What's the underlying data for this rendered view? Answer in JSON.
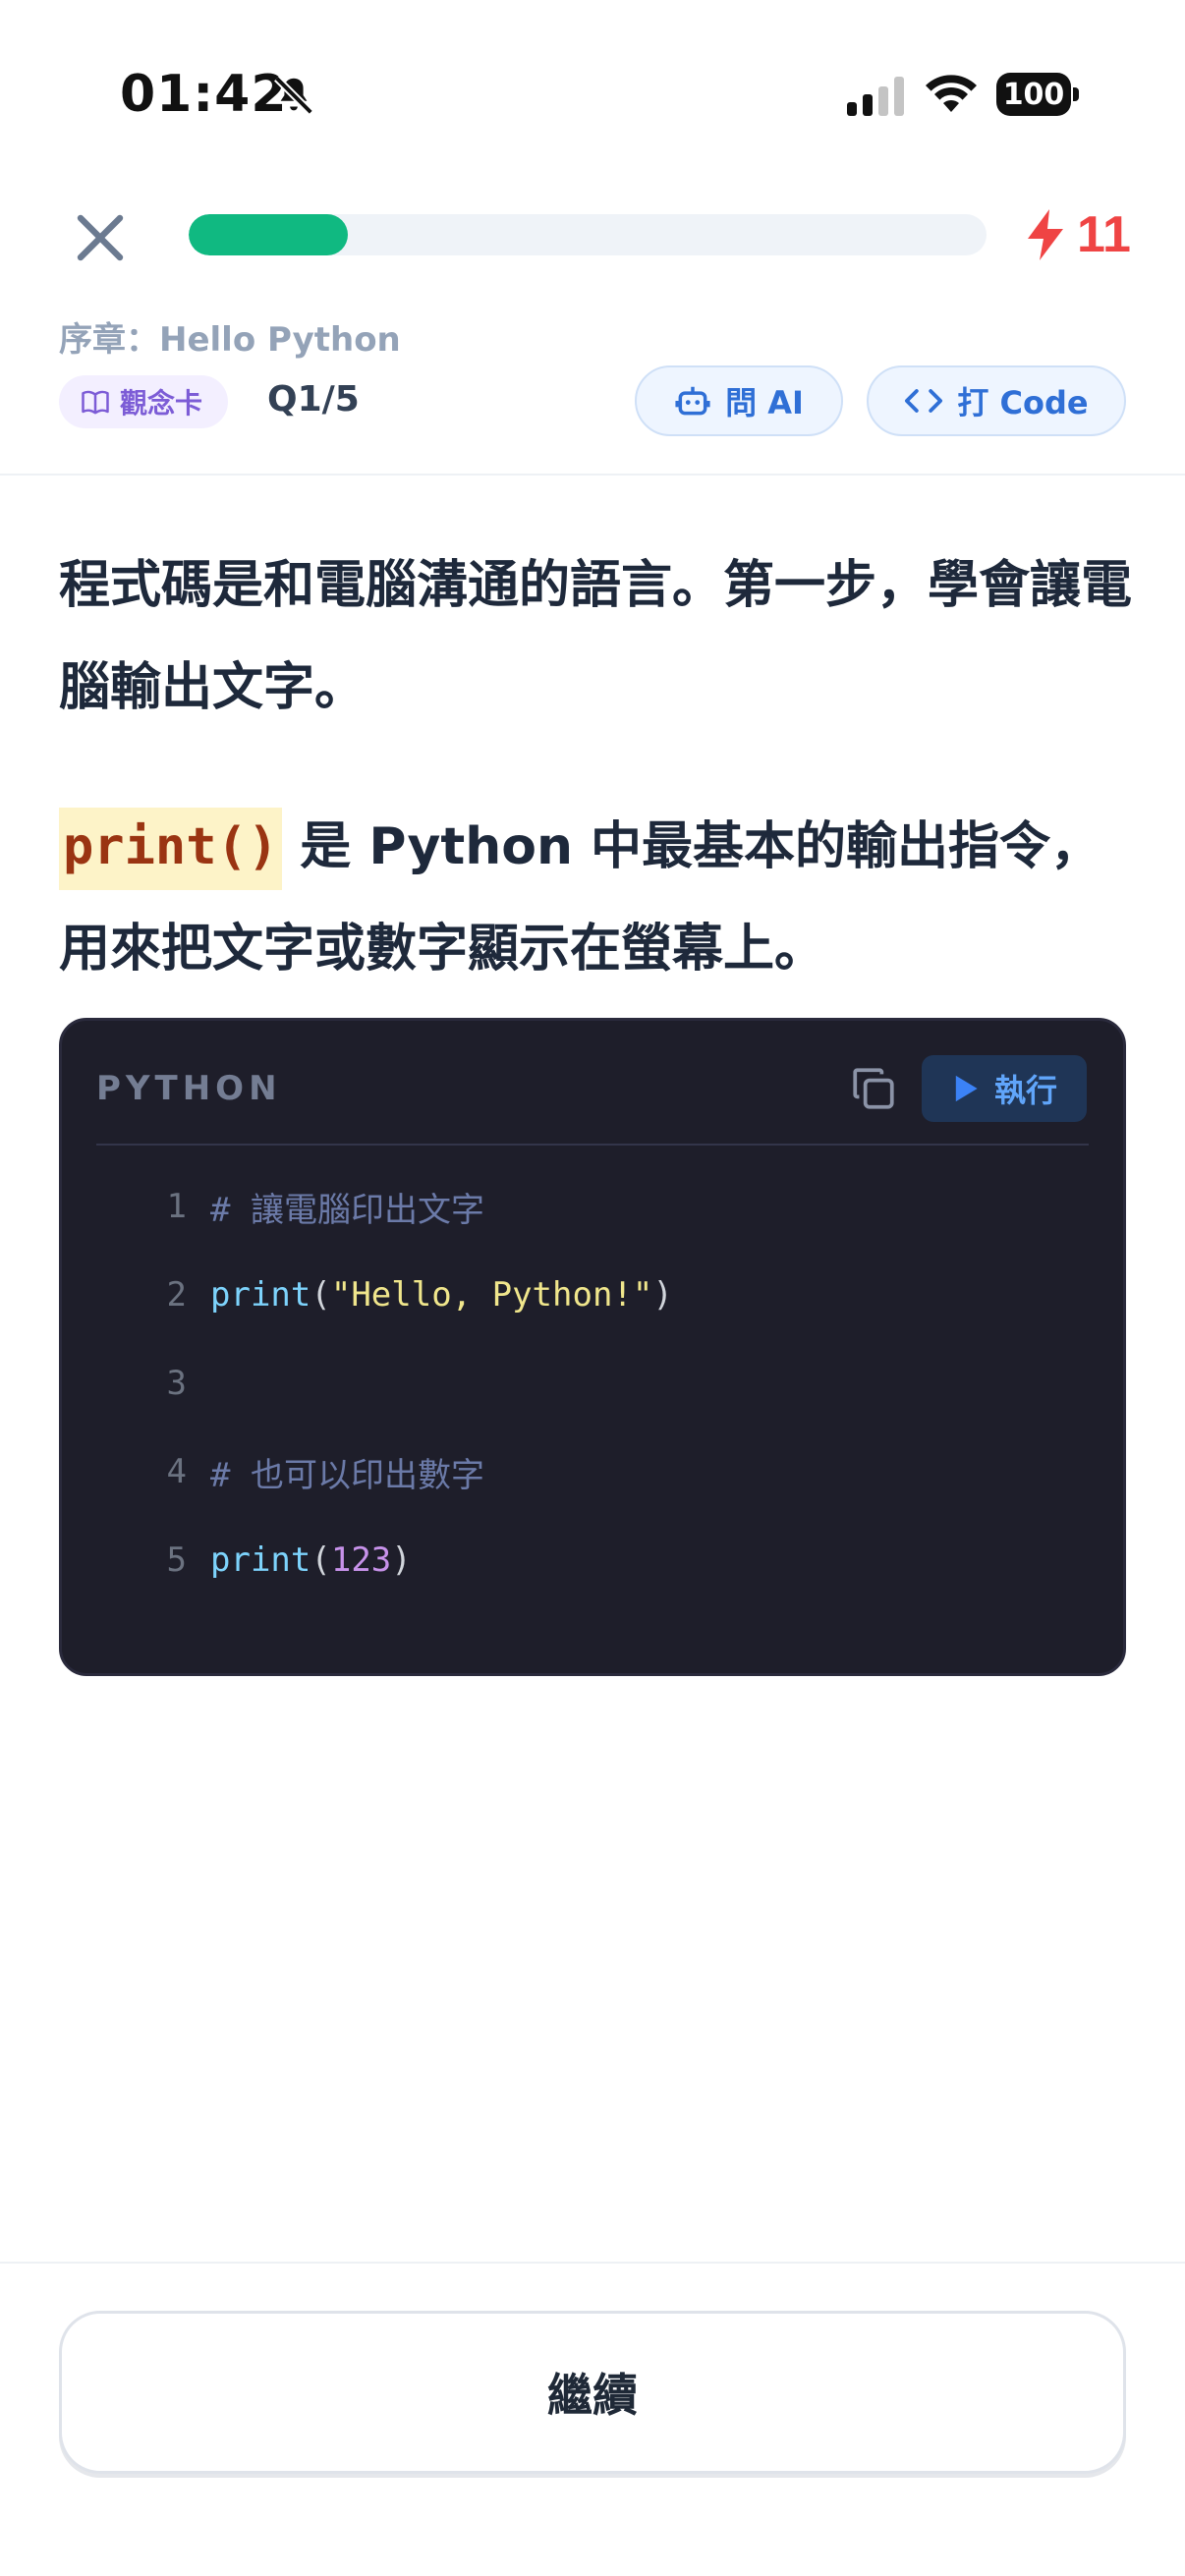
{
  "status_bar": {
    "time": "01:42",
    "battery": "100"
  },
  "header": {
    "progress_fraction": 0.2,
    "streak": "11",
    "chapter": "序章：Hello Python",
    "concept_tag": "觀念卡",
    "question_count": "Q1/5",
    "ask_ai_label": "問 AI",
    "type_code_label": "打 Code"
  },
  "content": {
    "para1": "程式碼是和電腦溝通的語言。第一步，學會讓電腦輸出文字。",
    "inline_code": "print()",
    "para2_rest": " 是 Python 中最基本的輸出指令，用來把文字或數字顯示在螢幕上。"
  },
  "code_block": {
    "language": "PYTHON",
    "run_label": "執行",
    "lines": [
      {
        "n": "1",
        "comment": "# 讓電腦印出文字"
      },
      {
        "n": "2",
        "fn": "print",
        "open": "(",
        "str": "\"Hello, Python!\"",
        "close": ")"
      },
      {
        "n": "3"
      },
      {
        "n": "4",
        "comment": "# 也可以印出數字"
      },
      {
        "n": "5",
        "fn": "print",
        "open": "(",
        "num": "123",
        "close": ")"
      }
    ]
  },
  "footer": {
    "continue_label": "繼續"
  },
  "colors": {
    "progress": "#10b981",
    "streak": "#ef4444",
    "accent_blue": "#2f6fd6"
  },
  "icons": [
    "mute-bell-icon",
    "signal-icon",
    "wifi-icon",
    "battery-icon",
    "close-icon",
    "lightning-icon",
    "book-icon",
    "robot-icon",
    "code-brackets-icon",
    "copy-icon",
    "play-icon"
  ]
}
